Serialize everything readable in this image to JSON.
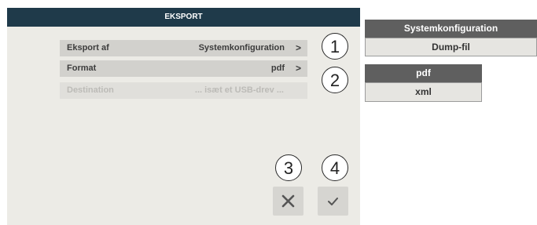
{
  "dialog": {
    "title": "EKSPORT",
    "rows": [
      {
        "label": "Eksport af",
        "value": "Systemkonfiguration",
        "chevron": ">",
        "enabled": true
      },
      {
        "label": "Format",
        "value": "pdf",
        "chevron": ">",
        "enabled": true
      },
      {
        "label": "Destination",
        "value": "... isæt et USB-drev ...",
        "enabled": false
      }
    ],
    "actions": {
      "cancel_icon": "close-icon",
      "confirm_icon": "check-icon"
    }
  },
  "callouts": [
    "1",
    "2",
    "3",
    "4"
  ],
  "popups": {
    "export_options": {
      "selected": "Systemkonfiguration",
      "other": "Dump-fil"
    },
    "format_options": {
      "selected": "pdf",
      "other": "xml"
    }
  },
  "colors": {
    "titlebar": "#1f3a4a",
    "dialog_bg": "#ecebe6",
    "selected_option": "#5f5f5f"
  }
}
